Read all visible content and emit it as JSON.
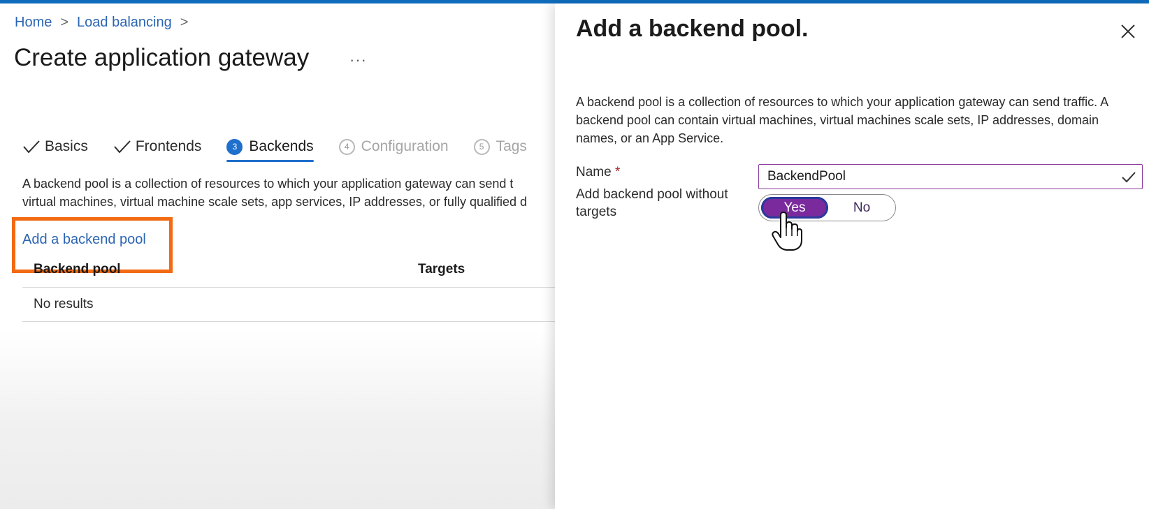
{
  "breadcrumb": {
    "home": "Home",
    "load_balancing": "Load balancing",
    "separator": ">"
  },
  "page": {
    "title": "Create application gateway",
    "more": "···"
  },
  "tabs": [
    {
      "label": "Basics",
      "state": "completed"
    },
    {
      "label": "Frontends",
      "state": "completed"
    },
    {
      "label": "Backends",
      "number": "3",
      "state": "active"
    },
    {
      "label": "Configuration",
      "number": "4",
      "state": "disabled"
    },
    {
      "label": "Tags",
      "number": "5",
      "state": "disabled"
    }
  ],
  "main": {
    "description_line1": "A backend pool is a collection of resources to which your application gateway can send t",
    "description_line2": "virtual machines, virtual machine scale sets, app services, IP addresses, or fully qualified d",
    "add_link": "Add a backend pool",
    "table": {
      "headers": [
        "Backend pool",
        "Targets"
      ],
      "empty_text": "No results"
    }
  },
  "panel": {
    "title": "Add a backend pool.",
    "description": "A backend pool is a collection of resources to which your application gateway can send traffic. A backend pool can contain virtual machines, virtual machines scale sets, IP addresses, domain names, or an App Service.",
    "name_label": "Name",
    "required_mark": "*",
    "name_value": "BackendPool",
    "targets_label": "Add backend pool without targets",
    "toggle": {
      "yes": "Yes",
      "no": "No",
      "selected": "Yes"
    }
  },
  "colors": {
    "accent": "#0f6cbd",
    "link": "#2b65b2",
    "highlight": "#f26a12",
    "toggle_on": "#7a2a9c",
    "input_border": "#8c3a9c"
  },
  "icons": [
    "chevron-right-icon",
    "checkmark-icon",
    "close-icon",
    "hand-pointer-cursor"
  ]
}
